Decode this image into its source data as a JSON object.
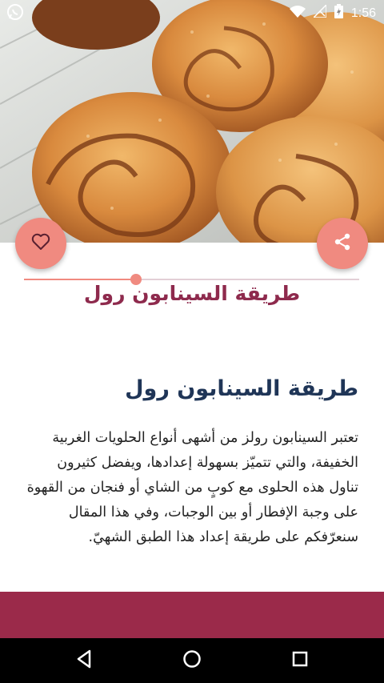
{
  "status_bar": {
    "time": "1:56",
    "icons": [
      "whatsapp-icon",
      "wifi-icon",
      "no-signal-icon",
      "battery-charging-icon"
    ]
  },
  "hero": {
    "image": "cinnamon-rolls-photo"
  },
  "actions": {
    "like_icon": "heart-outline-icon",
    "share_icon": "share-icon",
    "fab_color": "#f08a80"
  },
  "reading_progress": {
    "fraction": 0.335
  },
  "header": {
    "title": "طريقة السينابون رول",
    "color": "#8e2a4d"
  },
  "article": {
    "heading": "طريقة السينابون رول",
    "body": "تعتبر السينابون رولز من أشهى أنواع الحلويات الغربية الخفيفة، والتي تتميّز بسهولة إعدادها، ويفضل كثيرون تناول هذه الحلوى مع كوبٍ من الشاي أو فنجان من القهوة على وجبة الإفطار أو بين الوجبات، وفي هذا المقال سنعرّفكم على طريقة إعداد هذا الطبق الشهيّ.",
    "heading_color": "#1f3557"
  },
  "banner": {
    "color": "#9b2a4a"
  },
  "nav": {
    "back_icon": "back-triangle-icon",
    "home_icon": "home-circle-icon",
    "recents_icon": "recents-square-icon"
  }
}
